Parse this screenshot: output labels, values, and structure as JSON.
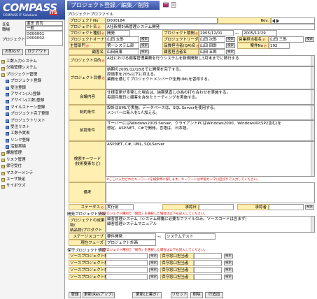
{
  "app": {
    "logo_text": "COMPASS",
    "logo_sub": "COMPASS IT Solutions",
    "logo_badge": "ITS"
  },
  "user": {
    "name_label": "氏名",
    "name_value": "堀田 真司",
    "org_label": "職場",
    "org_value": "一般",
    "project_label": "プロジェクト",
    "project_values": [
      "D000001",
      "D000002"
    ]
  },
  "left_buttons": {
    "notice": "お知らせ",
    "logout": "ログアウト"
  },
  "tree": [
    {
      "label": "工数入力システム",
      "level": 0
    },
    {
      "label": "欠陥管理システム",
      "level": 0
    },
    {
      "label": "プロジェクト管理",
      "level": 0
    },
    {
      "label": "プロジェクト登録",
      "level": 1
    },
    {
      "label": "受注登録",
      "level": 1
    },
    {
      "label": "アサイン(人)登録",
      "level": 1
    },
    {
      "label": "アサイン(工数)登録",
      "level": 1
    },
    {
      "label": "マイルストーン登録",
      "level": 1
    },
    {
      "label": "プロジェクト完了登録",
      "level": 1
    },
    {
      "label": "プロジェクトリスト",
      "level": 1
    },
    {
      "label": "受注リスト",
      "level": 1
    },
    {
      "label": "工数予実表",
      "level": 1
    },
    {
      "label": "リンク登録",
      "level": 1
    },
    {
      "label": "活動実績",
      "level": 1
    },
    {
      "label": "課題管理",
      "level": 0
    },
    {
      "label": "リスク管理",
      "level": 0
    },
    {
      "label": "保守受付",
      "level": 0
    },
    {
      "label": "マスターメンテ",
      "level": 0
    },
    {
      "label": "ユーザ設定",
      "level": 0
    },
    {
      "label": "サイボウズ",
      "level": 0
    }
  ],
  "header": {
    "title": "プロジェクト登録／編集／削除"
  },
  "section_profile": "プロジェクトプロファイル",
  "form": {
    "project_no_label": "プロジェクトNo",
    "project_no": "D000184",
    "rev_label": "Rev.",
    "project_name_label": "プロジェクト名",
    "project_name": "A社新規計画管理システム開発",
    "category_label": "プロジェクト種別",
    "category": "開発",
    "period_label": "プロジェクト期間",
    "period_from": "2005/12/01",
    "period_to": "2005/12/29",
    "owner_label": "プロジェクトオーナー",
    "owner": "山田 太郎",
    "leader_label": "プロジェクトリーダー",
    "leader": "山田 次郎",
    "sales_label": "営業担当者名",
    "sales": "山田 三郎",
    "dept_label": "主管部門",
    "dept": "第一システム部",
    "qa_label": "品質担当者(QA)名",
    "qa": "山田 四郎",
    "case_no_label": "案件No",
    "case_no": "192",
    "client_label": "顧客名",
    "client": "山田商事",
    "client_rep_label": "顧客担当者名",
    "client_rep": "山田 五郎",
    "purpose_label": "プロジェクト目的",
    "purpose": "A社における顧客管理業務を行うシステムを新規開発し3月末までに移行する",
    "goal_label": "プロジェクト目標",
    "goal": "納期の2005/12/18までに開発を完了する。\n原価率を70%以下に抑える。\n業務を通じてプロジェクトメンバーが全員UMLを習得する。",
    "meeting_label": "会議内容",
    "meeting": "仕様変更が多発した場合は、納期見直しの為の打ち合わせを実施する。\n毎週月曜日に顧客を含めたミーティングを実施する。",
    "constraint_label": "制約条件",
    "constraint": "設計はUMLで実施。データベースは、SQL Serverを使用する。\nメンバーに新人を1人加える。",
    "premise_label": "前提条件",
    "premise": "サーバーにはWindows2003 Server、クライアントPCはWindows2000、WindowsXP(SP2含む)を\n想定。ASP.NET、C#で開発。言語は、日本語。",
    "keyword_label": "検索キーワード\n(技術要素など)",
    "keyword": "ASP.NET, C#, UML, SQLServer",
    "keyword_note": "※ここに入力されたキーワードを検索時に探します。キーワードは半角カンマ(,)区切りで入力してください。",
    "remarks_label": "備考",
    "remarks": "",
    "status_label": "ステータス",
    "status": "実行前",
    "approve_date_label": "承認日",
    "approve_date": "",
    "approver_label": "承認者",
    "approver": ""
  },
  "section_dev": {
    "title": "開発プロジェクト情報",
    "note": "※プロジェクト種別で「開発」を選択した場合は以下も記入してください。",
    "scope_label": "プロジェクトの成果物/\n納品物(プロダクトスコープ)",
    "scope": "顧客管理システム（システム稼働に必要なファイルのみ。ソースコードは含まず）\n顧客管理システムマニュアル",
    "stage_label": "ステージスコープ",
    "stage_from": "要件開発",
    "stage_to": "システムテスト",
    "phase_label": "現在フェーズ",
    "phase": "プロジェクト計画"
  },
  "section_maint": {
    "title": "保守プロジェクト情報",
    "note": "※プロジェクト種別で「保守」を選択した場合は以下も記入してください。",
    "source_label": "ソースプロジェクトNo",
    "maint_label": "保守窓口担当者"
  },
  "small_btn": "検索",
  "bottom_buttons": [
    "登録",
    "更新(Revアップ)",
    "更新(上書き)",
    "リセット",
    "削除",
    "行追加"
  ]
}
